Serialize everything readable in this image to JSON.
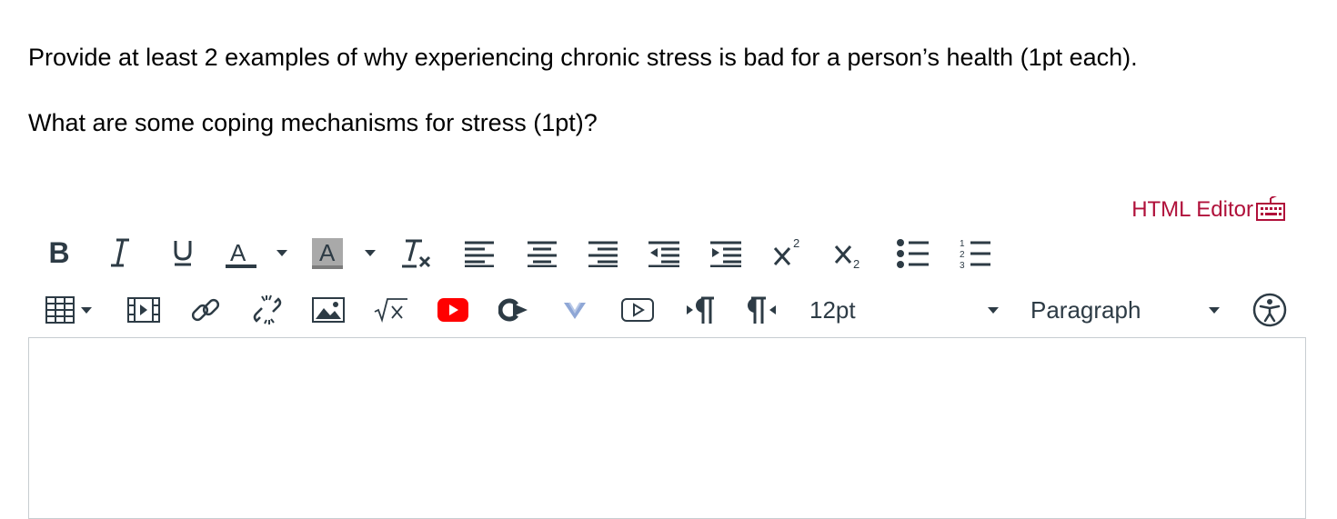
{
  "question": {
    "line1": "Provide at least 2 examples of why experiencing chronic stress is bad for a person’s health (1pt each).",
    "line2": "What are some coping mechanisms for stress (1pt)?"
  },
  "editor": {
    "html_editor_label": "HTML Editor",
    "font_size": "12pt",
    "block_format": "Paragraph",
    "content": ""
  },
  "toolbar": {
    "row1": [
      "bold-icon",
      "italic-icon",
      "underline-icon",
      "text-color-icon",
      "background-color-icon",
      "clear-formatting-icon",
      "align-left-icon",
      "align-center-icon",
      "align-right-icon",
      "outdent-icon",
      "indent-icon",
      "superscript-icon",
      "subscript-icon",
      "bullet-list-icon",
      "numbered-list-icon"
    ],
    "row2": [
      "table-icon",
      "media-icon",
      "link-icon",
      "unlink-icon",
      "image-icon",
      "equation-icon",
      "youtube-icon",
      "lti-tool-icon",
      "vimeo-icon",
      "record-media-icon",
      "ltr-icon",
      "rtl-icon",
      "font-size-select",
      "block-format-select",
      "accessibility-icon"
    ]
  },
  "colors": {
    "accent": "#b0103a",
    "icon": "#2d3b45",
    "youtube": "#ff0000",
    "vimeo": "#8fa7d6",
    "border": "#c7cdd1"
  }
}
